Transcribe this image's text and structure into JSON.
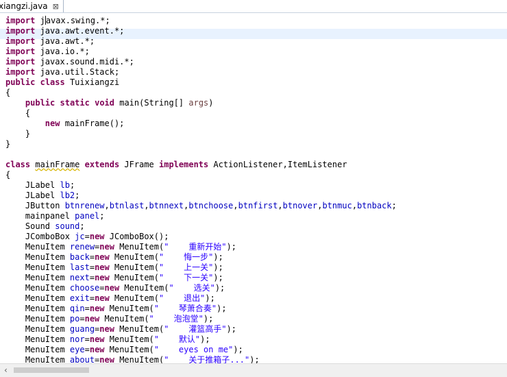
{
  "tab": {
    "title": "xiangzi.java",
    "close_icon": "⊠"
  },
  "code_lines": [
    "import javax.swing.*;",
    "import java.awt.event.*;",
    "import java.awt.*;",
    "import java.io.*;",
    "import javax.sound.midi.*;",
    "import java.util.Stack;",
    "public class Tuixiangzi",
    "{",
    "    public static void main(String[] args)",
    "    {",
    "        new mainFrame();",
    "    }",
    "}",
    "",
    "class mainFrame extends JFrame implements ActionListener,ItemListener",
    "{",
    "    JLabel lb;",
    "    JLabel lb2;",
    "    JButton btnrenew,btnlast,btnnext,btnchoose,btnfirst,btnover,btnmuc,btnback;",
    "    mainpanel panel;",
    "    Sound sound;",
    "    JComboBox jc=new JComboBox();",
    "    MenuItem renew=new MenuItem(\"    重新开始\");",
    "    MenuItem back=new MenuItem(\"    悔一步\");",
    "    MenuItem last=new MenuItem(\"    上一关\");",
    "    MenuItem next=new MenuItem(\"    下一关\");",
    "    MenuItem choose=new MenuItem(\"    选关\");",
    "    MenuItem exit=new MenuItem(\"    退出\");",
    "    MenuItem qin=new MenuItem(\"    琴萧合奏\");",
    "    MenuItem po=new MenuItem(\"    泡泡堂\");",
    "    MenuItem guang=new MenuItem(\"    灌篮高手\");",
    "    MenuItem nor=new MenuItem(\"    默认\");",
    "    MenuItem eye=new MenuItem(\"    eyes on me\");",
    "    MenuItem about=new MenuItem(\"    关于推箱子...\");"
  ],
  "colors": {
    "keyword": "#7f0055",
    "field": "#0000c0",
    "param": "#6a3e3e",
    "string": "#2a00ff",
    "current_line": "#e8f2fe"
  },
  "scrollbar": {
    "left_arrow_icon": "‹"
  }
}
